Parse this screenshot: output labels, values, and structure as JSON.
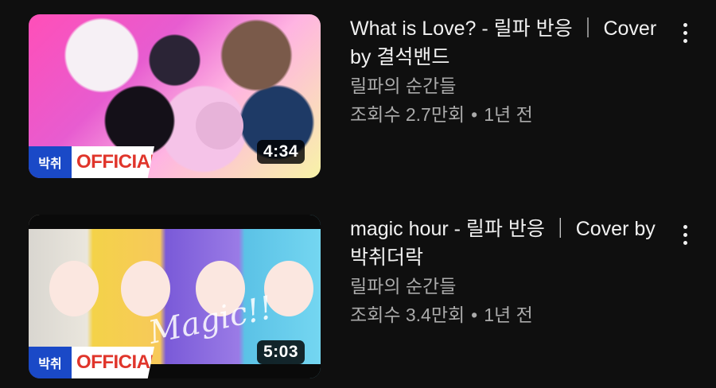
{
  "videos": [
    {
      "title": "What is Love? - 릴파 반응 ｜ Cover by 결석밴드",
      "channel": "릴파의 순간들",
      "views": "조회수 2.7만회",
      "age": "1년 전",
      "separator": "•",
      "duration": "4:34",
      "badge_brand": "박취",
      "badge_official": "OFFICIAL",
      "menu_icon": "more-vert-icon"
    },
    {
      "title": "magic hour - 릴파 반응 ｜ Cover by 박취더락",
      "channel": "릴파의 순간들",
      "views": "조회수 3.4만회",
      "age": "1년 전",
      "separator": "•",
      "duration": "5:03",
      "badge_brand": "박취",
      "badge_official": "OFFICIAL",
      "thumb_script": "Magic!!",
      "menu_icon": "more-vert-icon"
    }
  ],
  "colors": {
    "background": "#0f0f0f",
    "title": "#f1f1f1",
    "secondary": "#aaaaaa",
    "badge_blue": "#1a49c7",
    "official_red": "#e0352b"
  }
}
